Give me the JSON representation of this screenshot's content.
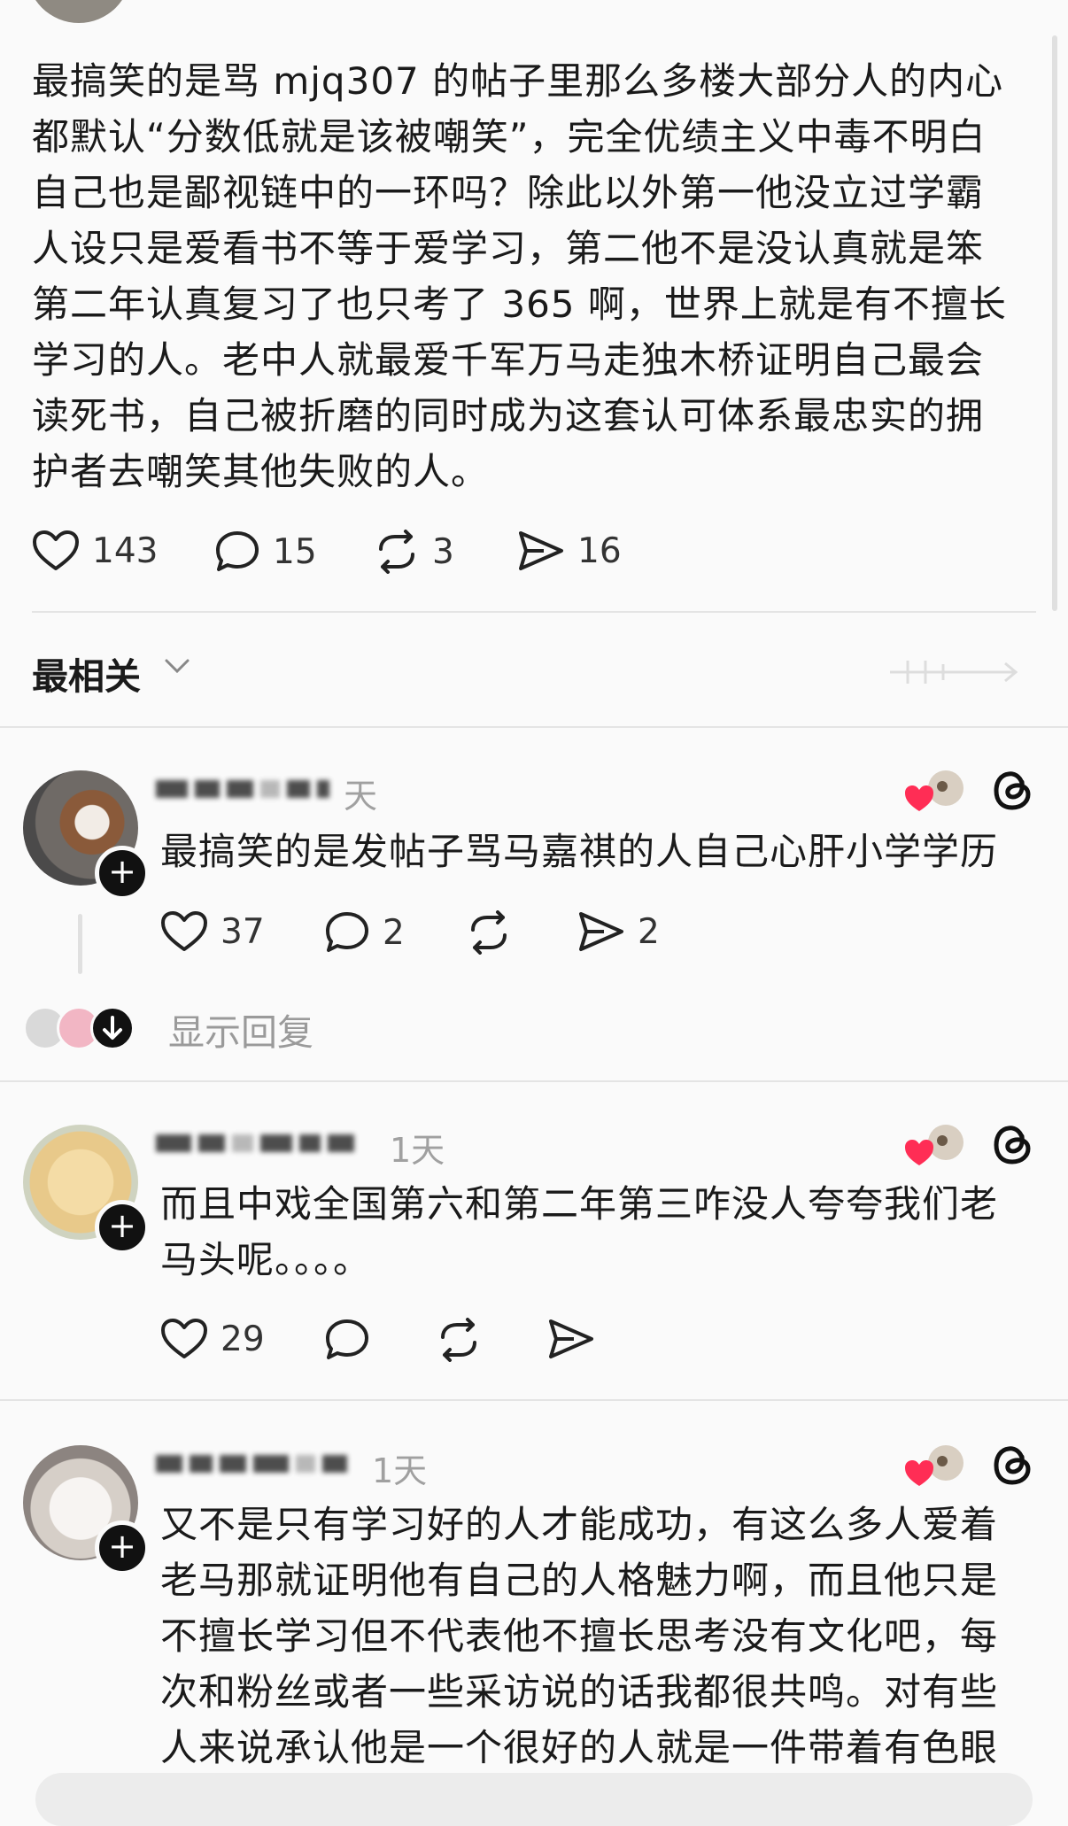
{
  "post": {
    "text_lines": [
      "最搞笑的是骂 mjq307 的帖子里那么多楼大部分人的内心",
      "都默认“分数低就是该被嘲笑”，完全优绩主义中毒不明白",
      "自己也是鄙视链中的一环吗？除此以外第一他没立过学霸",
      "人设只是爱看书不等于爱学习，第二他不是没认真就是笨",
      "第二年认真复习了也只考了 365 啊，世界上就是有不擅长",
      "学习的人。老中人就最爱千军万马走独木桥证明自己最会",
      "读死书，自己被折磨的同时成为这套认可体系最忠实的拥",
      "护者去嘲笑其他失败的人。"
    ],
    "likes": "143",
    "comments": "15",
    "reposts": "3",
    "shares": "16"
  },
  "sort": {
    "label": "最相关"
  },
  "replies": [
    {
      "time": "天",
      "text_lines": [
        "最搞笑的是发帖子骂马嘉祺的人自己心肝小学学历"
      ],
      "likes": "37",
      "comments": "2",
      "reposts": "",
      "shares": "2",
      "show_replies": "显示回复"
    },
    {
      "time": "1天",
      "text_lines": [
        "而且中戏全国第六和第二年第三咋没人夸夸我们老",
        "马头呢。。。。"
      ],
      "likes": "29",
      "comments": "",
      "reposts": "",
      "shares": ""
    },
    {
      "time": "1天",
      "text_lines": [
        "又不是只有学习好的人才能成功，有这么多人爱着",
        "老马那就证明他有自己的人格魅力啊，而且他只是",
        "不擅长学习但不代表他不擅长思考没有文化吧，每",
        "次和粉丝或者一些采访说的话我都很共鸣。对有些",
        "人来说承认他是一个很好的人就是一件带着有色眼"
      ]
    }
  ],
  "colors": {
    "heart_red": "#ff2d55",
    "text": "#1a1a1a",
    "muted": "#9a9a9a"
  },
  "icons": [
    "heart-icon",
    "comment-icon",
    "repost-icon",
    "share-icon",
    "chevron-down-icon",
    "threads-icon",
    "plus-icon",
    "arrow-down-icon"
  ]
}
